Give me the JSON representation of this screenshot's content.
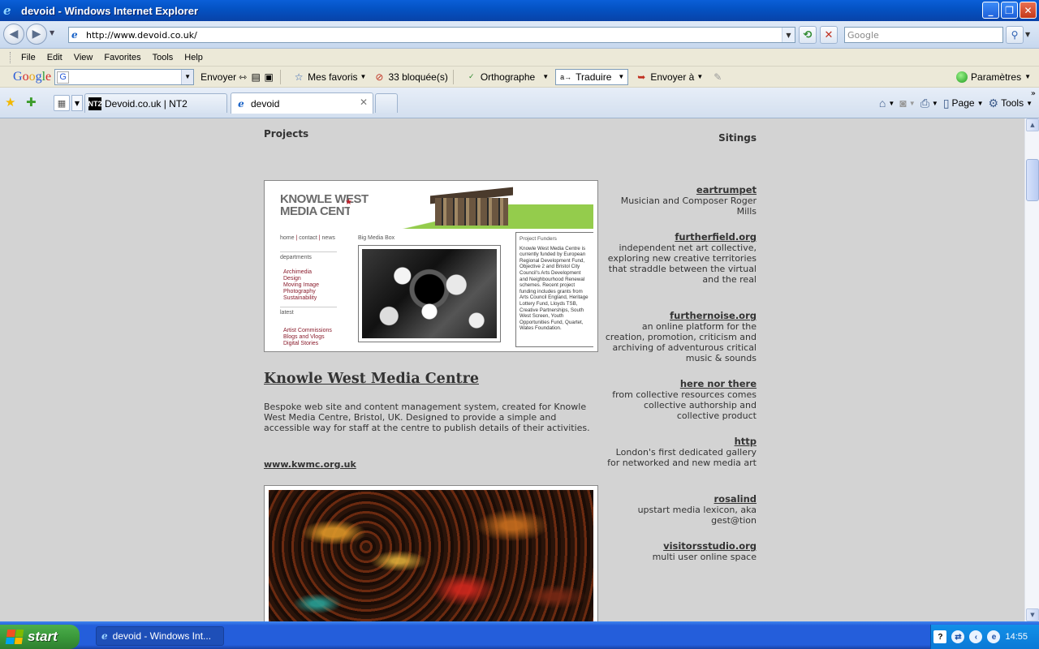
{
  "window": {
    "title": "devoid - Windows Internet Explorer",
    "minimize_label": "_",
    "maximize_label": "❐",
    "close_label": "✕"
  },
  "address_bar": {
    "url": "http://www.devoid.co.uk/",
    "search_placeholder": "Google"
  },
  "menu": {
    "items": [
      "File",
      "Edit",
      "View",
      "Favorites",
      "Tools",
      "Help"
    ]
  },
  "google_toolbar": {
    "logo": {
      "G": "G",
      "o1": "o",
      "o2": "o",
      "g": "g",
      "l": "l",
      "e": "e"
    },
    "send_label": "Envoyer",
    "favorites_label": "Mes favoris",
    "blocked_label": "33 bloquée(s)",
    "spelling_label": "Orthographe",
    "translate_label": "Traduire",
    "send_to_label": "Envoyer à",
    "settings_label": "Paramètres"
  },
  "tabs": [
    {
      "label": "Devoid.co.uk | NT2",
      "icon": "NT2"
    },
    {
      "label": "devoid",
      "icon": "ie-icon"
    }
  ],
  "command_bar": {
    "page_label": "Page",
    "tools_label": "Tools"
  },
  "page": {
    "projects_heading": "Projects",
    "sitings_heading": "Sitings",
    "project": {
      "title": "Knowle West Media Centre",
      "description": "Bespoke web site and content management system, created for Knowle West Media Centre, Bristol, UK. Designed to provide a simple and accessible way for staff at the centre to publish details of their activities.",
      "link": "www.kwmc.org.uk"
    },
    "screenshot": {
      "logo_line1": "KNOWLE WEST",
      "logo_line2": "MEDIA CENTRE",
      "nav_home": "home",
      "nav_contact": "contact",
      "nav_news": "news",
      "departments": "departments",
      "dept_items": [
        "Archimedia",
        "Design",
        "Moving Image",
        "Photography",
        "Sustainability"
      ],
      "latest": "latest",
      "latest_items": [
        "Artist Commissions",
        "Blogs and Vlogs",
        "Digital Stories"
      ],
      "big_media_box": "Big Media Box",
      "funders_title": "Project Funders",
      "funders_text": "Knowle West Media Centre is currently funded by European Regional Development Fund, Objective 2 and Bristol City Council's Arts Development and Neighbourhood Renewal schemes. Recent project funding includes grants from Arts Council England, Heritage Lottery Fund, Lloyds TSB, Creative Partnerships, South West Screen, Youth Opportunities Fund, Quartet, Wates Foundation."
    },
    "sitings": [
      {
        "name": "eartrumpet",
        "desc": "Musician and Composer Roger Mills"
      },
      {
        "name": "furtherfield.org",
        "desc": "independent net art collective, exploring new creative territories that straddle between the virtual and the real"
      },
      {
        "name": "furthernoise.org",
        "desc": "an online platform for the creation, promotion, criticism and archiving of adventurous critical music & sounds"
      },
      {
        "name": "here nor there",
        "desc": "from collective resources comes collective authorship and collective product"
      },
      {
        "name": "http",
        "desc": "London's first dedicated gallery for networked and new media art"
      },
      {
        "name": "rosalind",
        "desc": "upstart media lexicon, aka gest@tion"
      },
      {
        "name": "visitorsstudio.org",
        "desc": "multi user online space"
      }
    ]
  },
  "taskbar": {
    "start_label": "start",
    "task_label": "devoid - Windows Int...",
    "clock": "14:55"
  }
}
